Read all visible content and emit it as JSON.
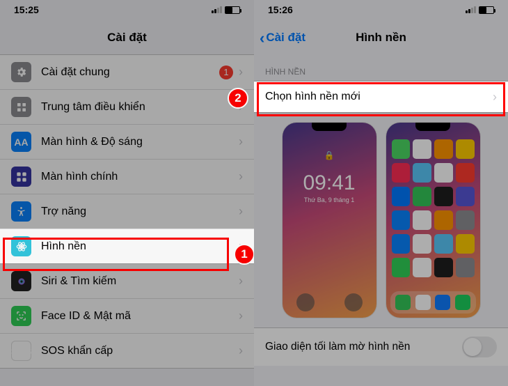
{
  "left": {
    "time": "15:25",
    "title": "Cài đặt",
    "rows": {
      "general": "Cài đặt chung",
      "general_badge": "1",
      "control_center": "Trung tâm điều khiển",
      "display": "Màn hình & Độ sáng",
      "home_screen": "Màn hình chính",
      "accessibility": "Trợ năng",
      "wallpaper": "Hình nền",
      "siri": "Siri & Tìm kiếm",
      "faceid": "Face ID & Mật mã",
      "sos": "SOS khẩn cấp"
    }
  },
  "right": {
    "time": "15:26",
    "back": "Cài đặt",
    "title": "Hình nền",
    "section": "HÌNH NỀN",
    "choose": "Chọn hình nền mới",
    "lock_time": "09:41",
    "lock_date": "Thứ Ba, 9 tháng 1",
    "dark_toggle": "Giao diện tối làm mờ hình nền"
  },
  "markers": {
    "one": "1",
    "two": "2"
  }
}
